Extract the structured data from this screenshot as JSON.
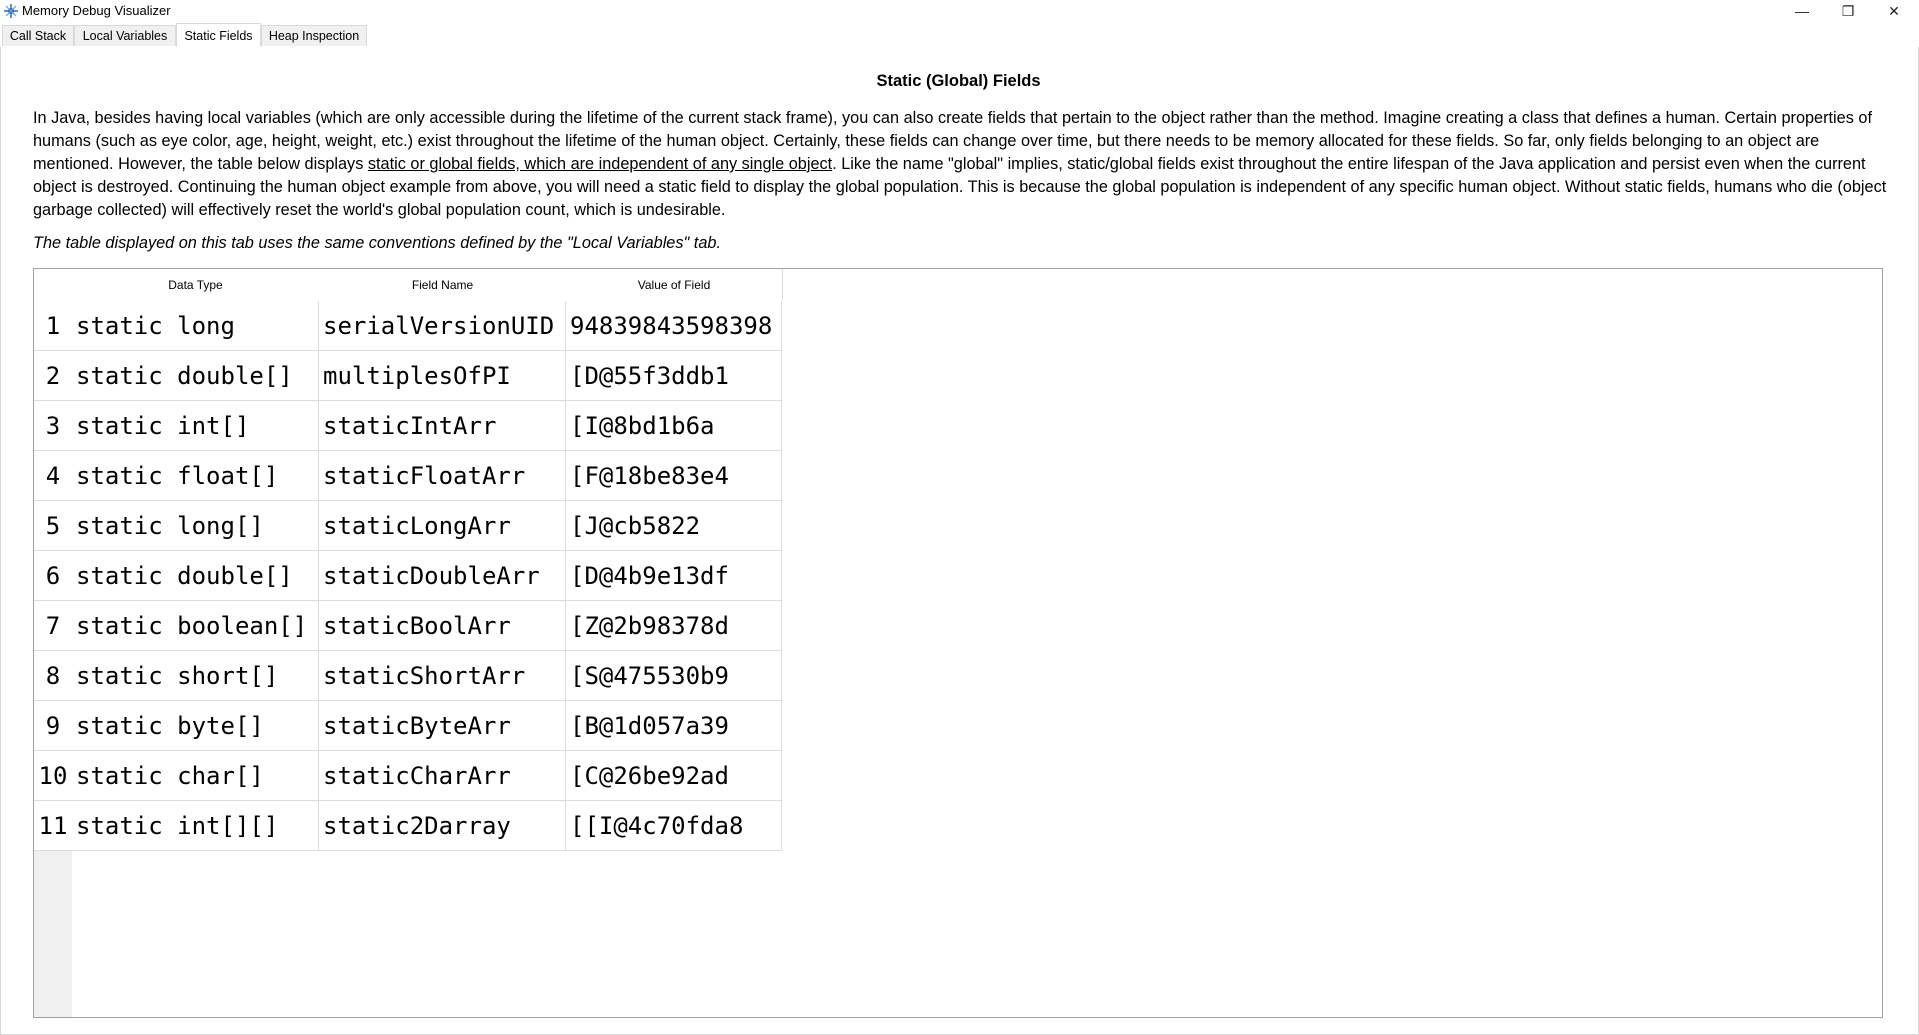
{
  "window": {
    "title": "Memory Debug Visualizer",
    "minimize_glyph": "—",
    "maximize_glyph": "❐",
    "close_glyph": "✕"
  },
  "tabs": [
    {
      "label": "Call Stack",
      "active": false
    },
    {
      "label": "Local Variables",
      "active": false
    },
    {
      "label": "Static Fields",
      "active": true
    },
    {
      "label": "Heap Inspection",
      "active": false
    }
  ],
  "content": {
    "heading": "Static (Global) Fields",
    "intro_part1": "In Java, besides having local variables (which are only accessible during the lifetime of the current stack frame), you can also create fields that pertain to the object rather than the method. Imagine creating a class that defines a human. Certain properties of humans (such as eye color, age, height, weight, etc.) exist throughout the lifetime of the human object. Certainly, these fields can change over time, but there needs to be memory allocated for these fields. So far, only fields belonging to an object are mentioned. However, the table below displays ",
    "intro_underlined": "static or global fields, which are independent of any single object",
    "intro_part2": ". Like the name \"global\" implies, static/global fields exist throughout the entire lifespan of the Java application and persist even when the current object is destroyed. Continuing the human object example from above, you will need a static field to display the global population. This is because the global population is independent of any specific human object. Without static fields, humans who die (object garbage collected) will effectively reset the world's global population count, which is undesirable.",
    "note": "The table displayed on this tab uses the same conventions defined by the \"Local Variables\" tab."
  },
  "table": {
    "columns": [
      "Data Type",
      "Field Name",
      "Value of Field"
    ],
    "rows": [
      {
        "num": "1",
        "type": "static long",
        "name": "serialVersionUID",
        "value": "94839843598398"
      },
      {
        "num": "2",
        "type": "static double[]",
        "name": "multiplesOfPI",
        "value": "[D@55f3ddb1"
      },
      {
        "num": "3",
        "type": "static int[]",
        "name": "staticIntArr",
        "value": "[I@8bd1b6a"
      },
      {
        "num": "4",
        "type": "static float[]",
        "name": "staticFloatArr",
        "value": "[F@18be83e4"
      },
      {
        "num": "5",
        "type": "static long[]",
        "name": "staticLongArr",
        "value": "[J@cb5822"
      },
      {
        "num": "6",
        "type": "static double[]",
        "name": "staticDoubleArr",
        "value": "[D@4b9e13df"
      },
      {
        "num": "7",
        "type": "static boolean[]",
        "name": "staticBoolArr",
        "value": "[Z@2b98378d"
      },
      {
        "num": "8",
        "type": "static short[]",
        "name": "staticShortArr",
        "value": "[S@475530b9"
      },
      {
        "num": "9",
        "type": "static byte[]",
        "name": "staticByteArr",
        "value": "[B@1d057a39"
      },
      {
        "num": "10",
        "type": "static char[]",
        "name": "staticCharArr",
        "value": "[C@26be92ad"
      },
      {
        "num": "11",
        "type": "static int[][]",
        "name": "static2Darray",
        "value": "[[I@4c70fda8"
      }
    ]
  }
}
